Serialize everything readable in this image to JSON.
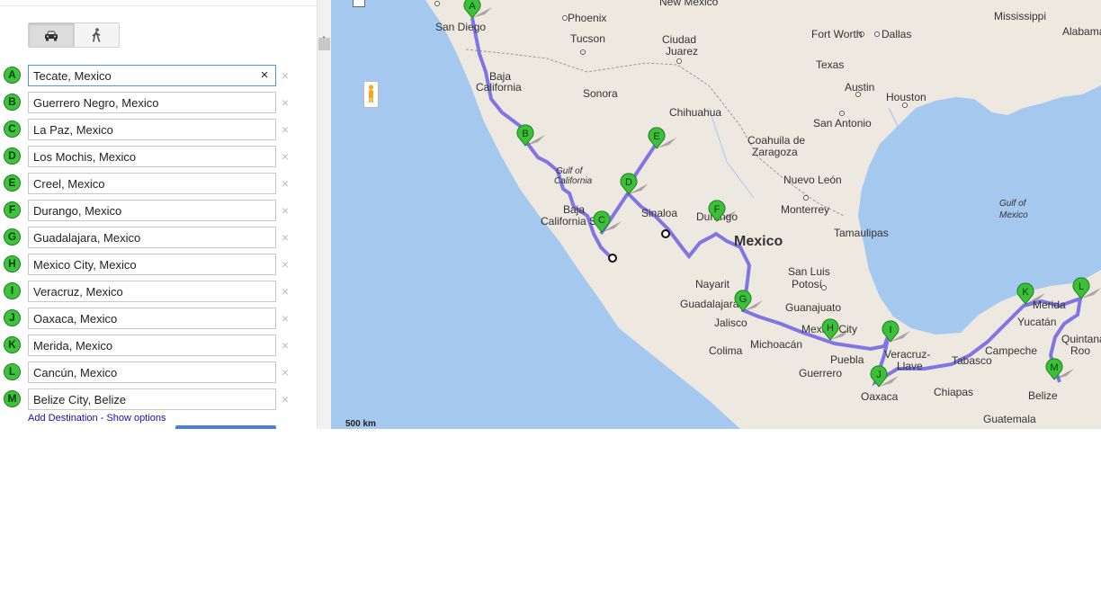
{
  "panel": {
    "mode_icons": [
      "car-icon",
      "walk-icon"
    ],
    "destinations": [
      {
        "marker": "A",
        "value": "Tecate, Mexico"
      },
      {
        "marker": "B",
        "value": "Guerrero Negro, Mexico"
      },
      {
        "marker": "C",
        "value": "La Paz, Mexico"
      },
      {
        "marker": "D",
        "value": "Los Mochis, Mexico"
      },
      {
        "marker": "E",
        "value": "Creel, Mexico"
      },
      {
        "marker": "F",
        "value": "Durango, Mexico"
      },
      {
        "marker": "G",
        "value": "Guadalajara, Mexico"
      },
      {
        "marker": "H",
        "value": "Mexico City, Mexico"
      },
      {
        "marker": "I",
        "value": "Veracruz, Mexico"
      },
      {
        "marker": "J",
        "value": "Oaxaca, Mexico"
      },
      {
        "marker": "K",
        "value": "Merida, Mexico"
      },
      {
        "marker": "L",
        "value": "Cancún, Mexico"
      },
      {
        "marker": "M",
        "value": "Belize City, Belize"
      }
    ],
    "clear_symbol": "×",
    "remove_symbol": "×",
    "add_destination": "Add Destination",
    "separator": " - ",
    "show_options": "Show options"
  },
  "map": {
    "scale": "500 km",
    "labels": {
      "san_diego": "San Diego",
      "phoenix": "Phoenix",
      "new_mexico": "New Mexico",
      "mississippi": "Mississippi",
      "alabama": "Alabama",
      "tucson": "Tucson",
      "ciudad_juarez_1": "Ciudad",
      "ciudad_juarez_2": "Juarez",
      "fort_worth": "Fort Worth",
      "dallas": "Dallas",
      "texas": "Texas",
      "baja_california_1": "Baja",
      "baja_california_2": "California",
      "sonora": "Sonora",
      "austin": "Austin",
      "houston": "Houston",
      "chihuahua": "Chihuahua",
      "san_antonio": "San Antonio",
      "coahuila_1": "Coahuila de",
      "coahuila_2": "Zaragoza",
      "gulf_california_1": "Gulf of",
      "gulf_california_2": "California",
      "nuevo_leon": "Nuevo León",
      "gulf_mexico_1": "Gulf of",
      "gulf_mexico_2": "Mexico",
      "baja_sur_1": "Baja",
      "baja_sur_2": "California Sur",
      "sinaloa": "Sinaloa",
      "durango": "Durango",
      "monterrey": "Monterrey",
      "tamaulipas": "Tamaulipas",
      "mexico": "Mexico",
      "san_luis_1": "San Luis",
      "san_luis_2": "Potosí",
      "nayarit": "Nayarit",
      "guadalajara": "Guadalajara",
      "guanajuato": "Guanajuato",
      "jalisco": "Jalisco",
      "mexico_city": "Mexico City",
      "merida": "Merida",
      "yucatan": "Yucatán",
      "quintana_1": "Quintana",
      "quintana_2": "Roo",
      "michoacan": "Michoacán",
      "veracruz_1": "Veracruz-",
      "veracruz_2": "Llave",
      "campeche": "Campeche",
      "colima": "Colima",
      "puebla": "Puebla",
      "tabasco": "Tabasco",
      "guerrero": "Guerrero",
      "oaxaca": "Oaxaca",
      "chiapas": "Chiapas",
      "belize": "Belize",
      "guatemala": "Guatemala"
    },
    "pins": [
      "A",
      "B",
      "C",
      "D",
      "E",
      "F",
      "G",
      "H",
      "I",
      "J",
      "K",
      "L",
      "M"
    ],
    "colors": {
      "water": "#a4c8ee",
      "land": "#ede9e0",
      "route": "#6c62e3",
      "pin": "#3cc03a"
    }
  }
}
